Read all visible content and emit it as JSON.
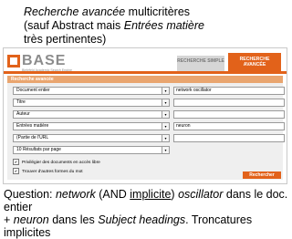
{
  "caption_top": {
    "line1_em": "Recherche avancée",
    "line1_rest": " multicritères",
    "line2_pre": "(sauf Abstract mais ",
    "line2_em": "Entrées matière",
    "line3": "très pertinentes)"
  },
  "base": {
    "logo_text": "BASE",
    "logo_sub": "Bielefeld Academic Search Engine",
    "tab_simple": "RECHERCHE SIMPLE",
    "tab_advanced": "RECHERCHE AVANCÉE",
    "panel_title": "Recherche avancée"
  },
  "form": {
    "rows": [
      {
        "field": "Document entier",
        "value": "network oscillator"
      },
      {
        "field": "Titre",
        "value": ""
      },
      {
        "field": "Auteur",
        "value": ""
      },
      {
        "field": "Entrées matière",
        "value": "neuron"
      },
      {
        "field": "(Partie de l'URL",
        "value": ""
      },
      {
        "field": "10 Résultats par page",
        "value": ""
      }
    ],
    "option1": "Privilégier des documents en accès libre",
    "option2": "Trouver d'autres formes du mot",
    "search_button": "Rechercher"
  },
  "caption_bottom": {
    "p1": "Question:  ",
    "p2_em": "network",
    "p3": " (AND ",
    "p4_u": "implicite",
    "p5": ") ",
    "p6_em": "oscillator",
    "p7": " dans le doc. entier",
    "p8": "+ ",
    "p9_em": "neuron",
    "p10": " dans les ",
    "p11_em": "Subject headings",
    "p12": ". Troncatures implicites"
  },
  "colors": {
    "accent": "#e2621a",
    "panel_title": "#e9a56f",
    "panel_bg": "#efefef"
  }
}
